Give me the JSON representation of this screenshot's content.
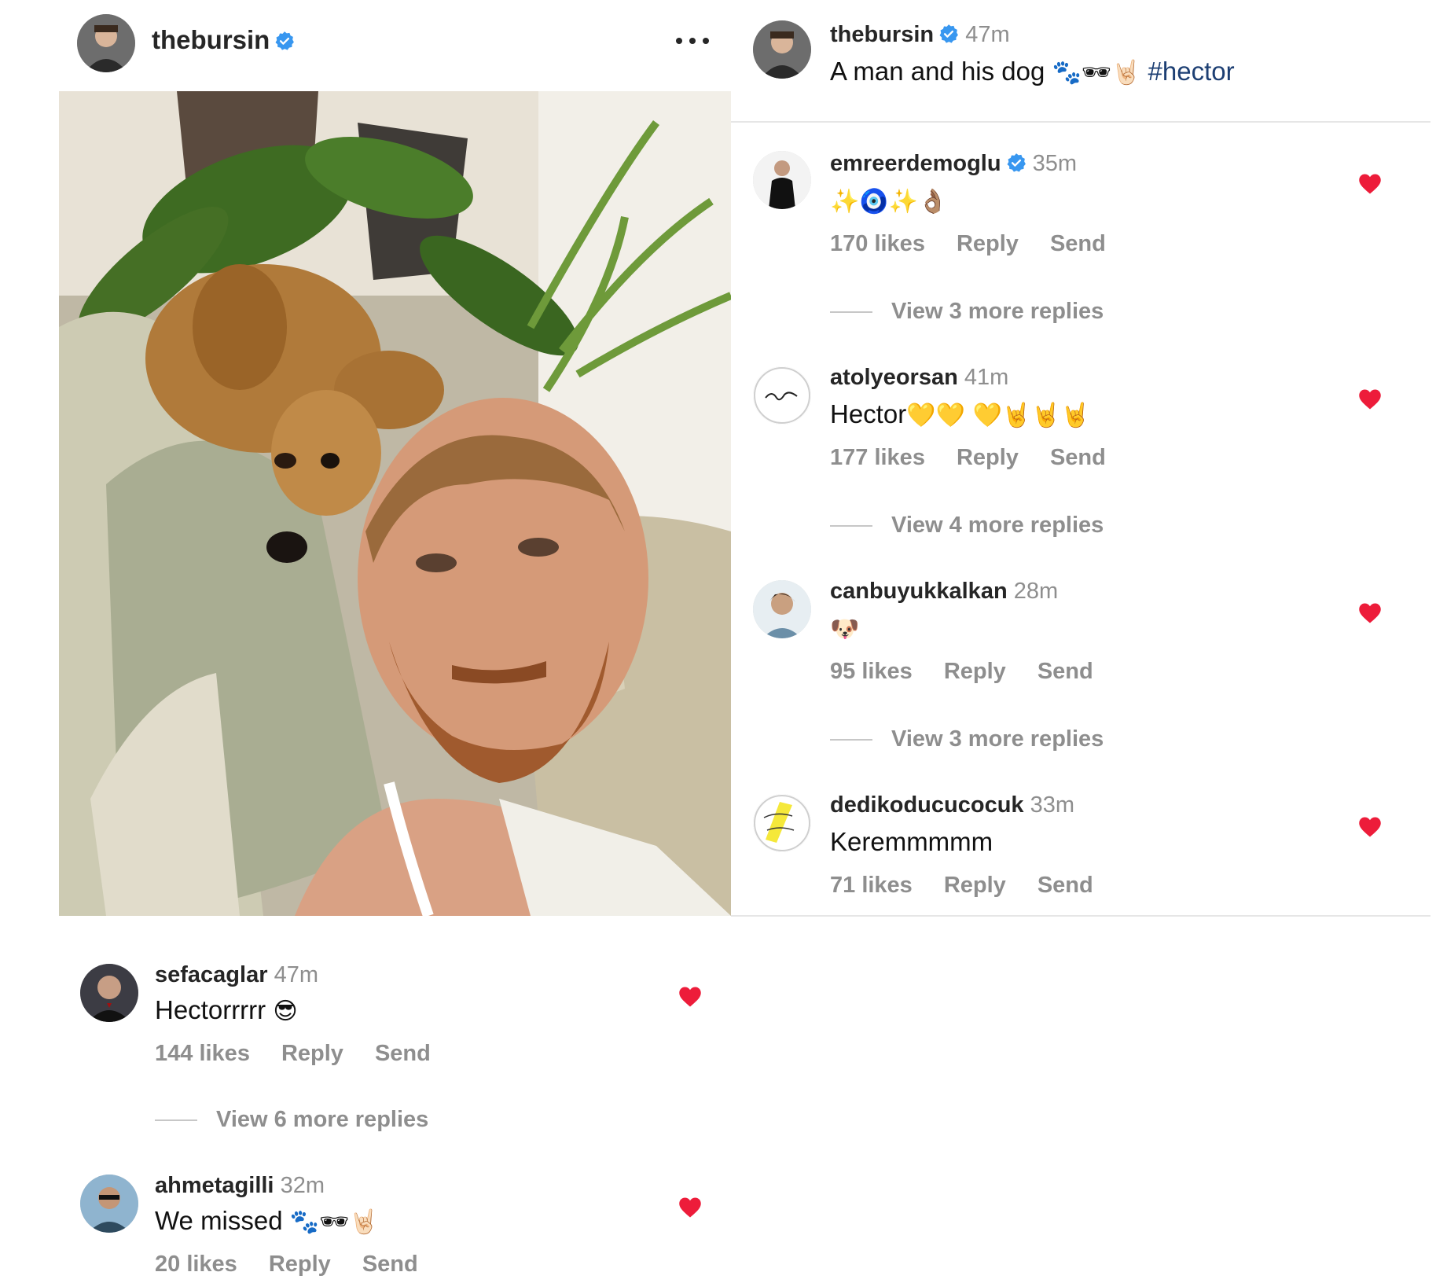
{
  "post": {
    "username": "thebursin",
    "verified": true,
    "more_label": "More options"
  },
  "caption": {
    "username": "thebursin",
    "time": "47m",
    "text": "A man and his dog",
    "emojis": "🐾🕶🤘🏻",
    "hashtag": "#hector"
  },
  "comments_right": [
    {
      "username": "emreerdemoglu",
      "verified": true,
      "time": "35m",
      "text": "",
      "emojis": "✨🧿✨👌🏽",
      "likes": "170 likes",
      "reply": "Reply",
      "send": "Send",
      "view_replies": "View 3 more replies",
      "liked": true
    },
    {
      "username": "atolyeorsan",
      "verified": false,
      "time": "41m",
      "text": "Hector",
      "emojis": "💛💛 💛🤘🤘🤘",
      "likes": "177 likes",
      "reply": "Reply",
      "send": "Send",
      "view_replies": "View 4 more replies",
      "liked": true
    },
    {
      "username": "canbuyukkalkan",
      "verified": false,
      "time": "28m",
      "text": "",
      "emojis": "🐶",
      "likes": "95 likes",
      "reply": "Reply",
      "send": "Send",
      "view_replies": "View 3 more replies",
      "liked": true
    },
    {
      "username": "dedikoducucocuk",
      "verified": false,
      "time": "33m",
      "text": "Keremmmmm",
      "emojis": "",
      "likes": "71 likes",
      "reply": "Reply",
      "send": "Send",
      "view_replies": "",
      "liked": true
    }
  ],
  "comments_left": [
    {
      "username": "sefacaglar",
      "time": "47m",
      "text": "Hectorrrrr",
      "emojis": "😎",
      "likes": "144 likes",
      "reply": "Reply",
      "send": "Send",
      "view_replies": "View 6 more replies",
      "liked": true
    },
    {
      "username": "ahmetagilli",
      "time": "32m",
      "text": "We missed",
      "emojis": "🐾🕶🤘🏻",
      "likes": "20 likes",
      "reply": "Reply",
      "send": "Send",
      "view_replies": "",
      "liked": true
    }
  ],
  "colors": {
    "heart": "#ed1c3a",
    "verified": "#3897f0",
    "hashtag": "#1d3f73",
    "secondary_text": "#8e8e8e"
  },
  "icons": [
    "verified-badge-icon",
    "more-icon",
    "heart-icon"
  ]
}
